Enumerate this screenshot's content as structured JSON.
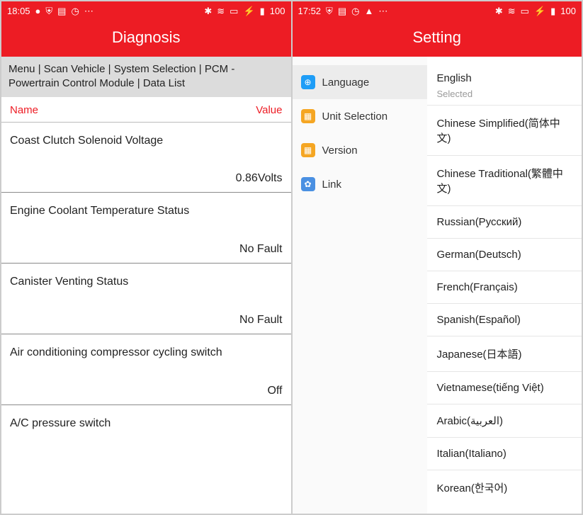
{
  "left": {
    "status": {
      "time": "18:05",
      "battery": "100"
    },
    "title": "Diagnosis",
    "breadcrumb": "Menu | Scan Vehicle | System Selection | PCM - Powertrain Control Module | Data List",
    "cols": {
      "name": "Name",
      "value": "Value"
    },
    "items": [
      {
        "name": "Coast Clutch Solenoid Voltage",
        "value": "0.86Volts"
      },
      {
        "name": "Engine Coolant Temperature Status",
        "value": "No Fault"
      },
      {
        "name": "Canister Venting Status",
        "value": "No Fault"
      },
      {
        "name": "Air conditioning compressor cycling switch",
        "value": "Off"
      },
      {
        "name": "A/C pressure switch",
        "value": ""
      }
    ]
  },
  "right": {
    "status": {
      "time": "17:52",
      "battery": "100"
    },
    "title": "Setting",
    "nav": [
      {
        "label": "Language"
      },
      {
        "label": "Unit Selection"
      },
      {
        "label": "Version"
      },
      {
        "label": "Link"
      }
    ],
    "selected_label": "Selected",
    "languages": [
      "English",
      "Chinese Simplified(简体中文)",
      "Chinese Traditional(繁體中文)",
      "Russian(Русский)",
      "German(Deutsch)",
      "French(Français)",
      "Spanish(Español)",
      "Japanese(日本語)",
      "Vietnamese(tiếng Việt)",
      "Arabic(العربية)",
      "Italian(Italiano)",
      "Korean(한국어)"
    ]
  }
}
